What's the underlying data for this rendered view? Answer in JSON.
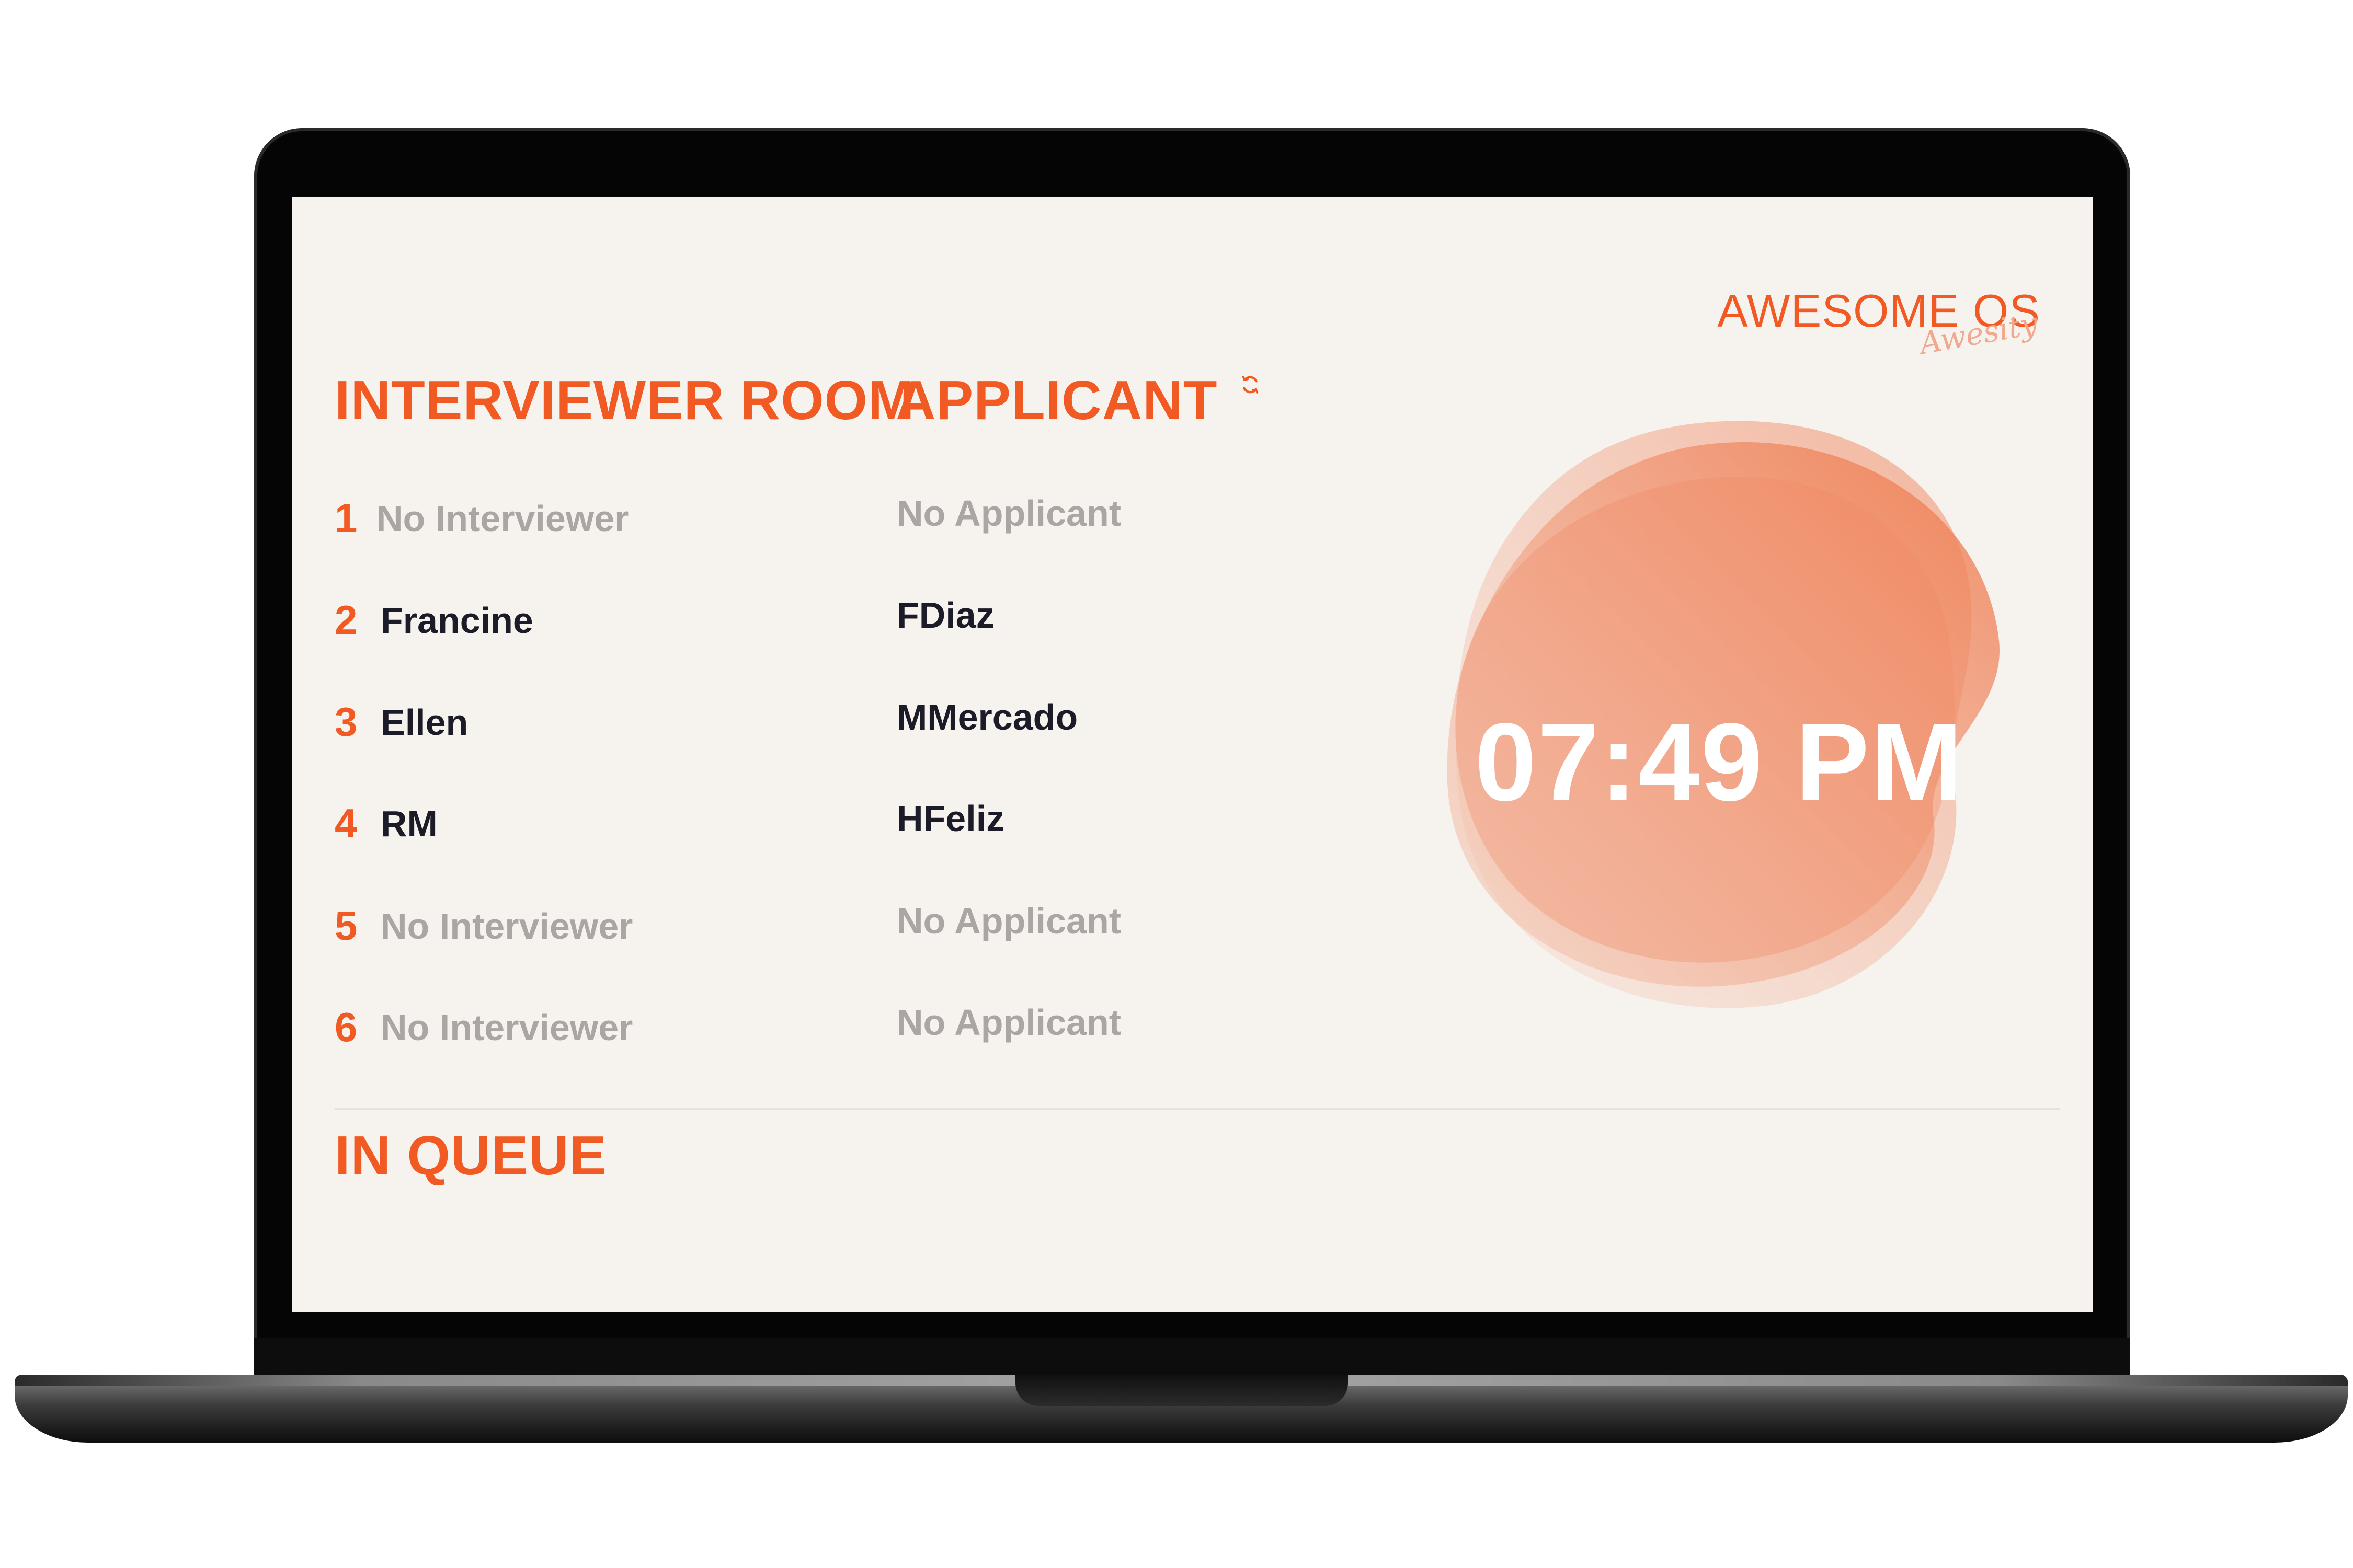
{
  "brand": {
    "name": "AWESOME OS",
    "script": "Awesity"
  },
  "headings": {
    "interviewer_room": "INTERVIEWER ROOM",
    "applicant": "APPLICANT",
    "in_queue": "IN QUEUE"
  },
  "rooms": [
    {
      "number": "1",
      "interviewer": "No Interviewer",
      "applicant": "No Applicant"
    },
    {
      "number": "2",
      "interviewer": "Francine",
      "applicant": "FDiaz"
    },
    {
      "number": "3",
      "interviewer": "Ellen",
      "applicant": "MMercado"
    },
    {
      "number": "4",
      "interviewer": "RM",
      "applicant": "HFeliz"
    },
    {
      "number": "5",
      "interviewer": "No Interviewer",
      "applicant": "No Applicant"
    },
    {
      "number": "6",
      "interviewer": "No Interviewer",
      "applicant": "No Applicant"
    }
  ],
  "clock": {
    "time": "07:49 PM"
  },
  "icons": {
    "refresh": "refresh-icon"
  },
  "colors": {
    "accent": "#f25a24",
    "screen_bg": "#f6f3ef",
    "empty_text": "#a9a6a4",
    "filled_text": "#1c1c28",
    "blob": "#f08a64"
  }
}
